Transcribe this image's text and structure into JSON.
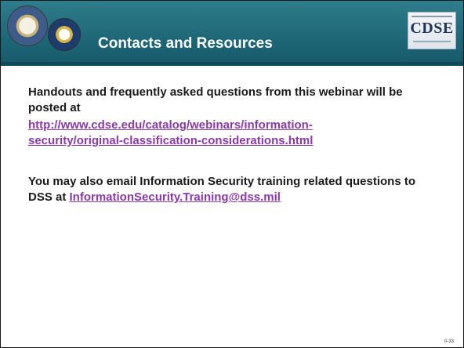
{
  "header": {
    "title": "Contacts and Resources",
    "logo_text": "CDSE",
    "left_seal_icon": "dod-seal-icon",
    "right_seal_icon": "dss-seal-icon",
    "colors": {
      "band": "#1f6878",
      "title_text": "#ffffff"
    }
  },
  "content": {
    "para1": "Handouts and frequently asked questions from this webinar will be posted at",
    "link1_line1": "http://www.cdse.edu/catalog/webinars/information-",
    "link1_line2": "security/original-classification-considerations.html",
    "para2_text": "You may also email Information Security training related questions to DSS at ",
    "email_link": "InformationSecurity.Training@dss.mil",
    "colors": {
      "link": "#8a3aa8",
      "body_text": "#1a1a1a"
    }
  },
  "footer": {
    "page_number": "0-33"
  }
}
